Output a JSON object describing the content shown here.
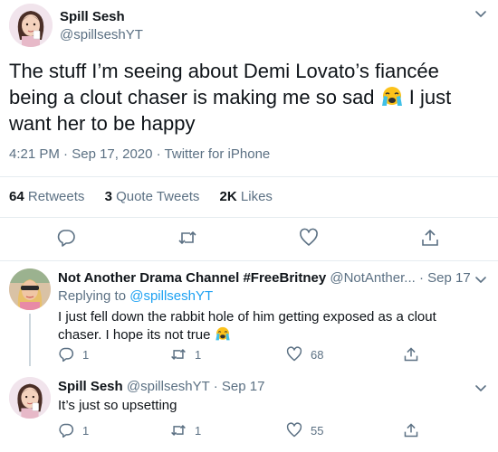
{
  "main_tweet": {
    "display_name": "Spill Sesh",
    "handle": "@spillseshYT",
    "text_part1": "The stuff I’m seeing about Demi Lovato’s fiancée being a clout chaser is making me so sad ",
    "emoji": "loudly-crying-face",
    "text_part2": " I just want her to be happy",
    "time": "4:21 PM",
    "date": "Sep 17, 2020",
    "source": "Twitter for iPhone",
    "separator": " · ",
    "retweets_count": "64",
    "retweets_label": "Retweets",
    "quotes_count": "3",
    "quotes_label": "Quote Tweets",
    "likes_count": "2K",
    "likes_label": "Likes"
  },
  "replies": [
    {
      "display_name": "Not Another Drama Channel #FreeBritney",
      "handle": "@NotAnther...",
      "time_sep": " · ",
      "date": "Sep 17",
      "replying_label": "Replying to ",
      "replying_handle": "@spillseshYT",
      "text": "I just fell down the rabbit hole of him getting exposed as a clout chaser. I hope its not true ",
      "replies_count": "1",
      "retweets_count": "1",
      "likes_count": "68"
    },
    {
      "display_name": "Spill Sesh",
      "handle": "@spillseshYT",
      "time_sep": " · ",
      "date": "Sep 17",
      "text": "It’s just so upsetting",
      "replies_count": "1",
      "retweets_count": "1",
      "likes_count": "55"
    }
  ],
  "colors": {
    "text": "#0f1419",
    "secondary": "#5b7083",
    "link": "#1da1f2",
    "divider": "#e6ecf0"
  }
}
